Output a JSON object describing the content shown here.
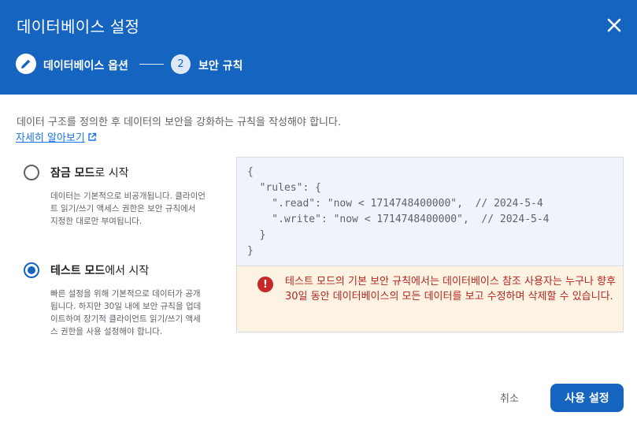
{
  "dialog": {
    "title": "데이터베이스 설정",
    "close_icon": "close-icon"
  },
  "stepper": {
    "step1": {
      "icon": "pencil-icon",
      "label": "데이터베이스 옵션"
    },
    "step2": {
      "number": "2",
      "label": "보안 규칙"
    }
  },
  "intro": {
    "text": "데이터 구조를 정의한 후 데이터의 보안을 강화하는 규칙을 작성해야 합니다.",
    "learn_more": "자세히 알아보기",
    "learn_more_icon": "open-in-new-icon"
  },
  "options": [
    {
      "title_bold": "잠금 모드",
      "title_rest": "로 시작",
      "description": "데이터는 기본적으로 비공개됩니다. 클라이언트 읽기/쓰기 액세스 권한은 보안 규칙에서 지정한 대로만 부여됩니다.",
      "selected": false
    },
    {
      "title_bold": "테스트 모드",
      "title_rest": "에서 시작",
      "description": "빠른 설정을 위해 기본적으로 데이터가 공개됩니다. 하지만 30일 내에 보안 규칙을 업데이트하여 장기적 클라이언트 읽기/쓰기 액세스 권한을 사용 설정해야 합니다.",
      "selected": true
    }
  ],
  "rules_code": {
    "line1": "{",
    "line2": "  \"rules\": {",
    "line3": "    \".read\": \"now < 1714748400000\",  // 2024-5-4",
    "line4": "    \".write\": \"now < 1714748400000\",  // 2024-5-4",
    "line5": "  }",
    "line6": "}"
  },
  "warning": {
    "icon": "error-icon",
    "text": "테스트 모드의 기본 보안 규칙에서는 데이터베이스 참조 사용자는 누구나 향후 30일 동안 데이터베이스의 모든 데이터를 보고 수정하며 삭제할 수 있습니다."
  },
  "actions": {
    "cancel": "취소",
    "confirm": "사용 설정"
  },
  "colors": {
    "header": "#1565c0",
    "accent": "#1565c0",
    "warning_bg": "#fef3e3",
    "warning_text": "#b3261e"
  }
}
